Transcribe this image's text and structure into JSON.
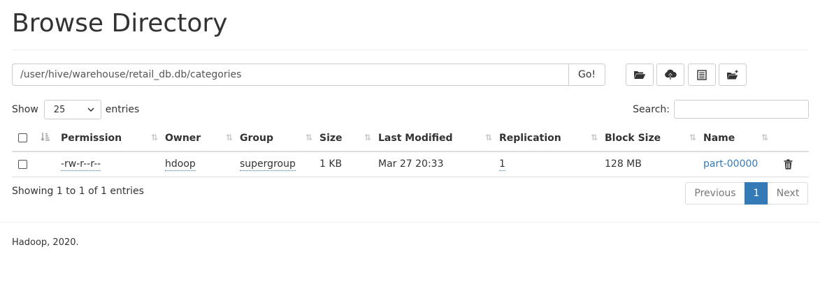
{
  "page": {
    "title": "Browse Directory"
  },
  "path_bar": {
    "value": "/user/hive/warehouse/retail_db.db/categories",
    "go_label": "Go!"
  },
  "toolbar": {
    "icons": [
      "folder-open-icon",
      "upload-icon",
      "list-icon",
      "new-folder-icon"
    ]
  },
  "length": {
    "show_label": "Show",
    "value": "25",
    "entries_label": "entries"
  },
  "search": {
    "label": "Search:",
    "value": ""
  },
  "table": {
    "columns": [
      "Permission",
      "Owner",
      "Group",
      "Size",
      "Last Modified",
      "Replication",
      "Block Size",
      "Name"
    ],
    "rows": [
      {
        "permission": "-rw-r--r--",
        "owner": "hdoop",
        "group": "supergroup",
        "size": "1 KB",
        "last_modified": "Mar 27 20:33",
        "replication": "1",
        "block_size": "128 MB",
        "name": "part-00000"
      }
    ]
  },
  "info": {
    "text": "Showing 1 to 1 of 1 entries"
  },
  "pagination": {
    "previous": "Previous",
    "current": "1",
    "next": "Next"
  },
  "footer": {
    "text": "Hadoop, 2020."
  },
  "colors": {
    "link": "#337ab7",
    "border": "#dddddd",
    "text": "#333333"
  }
}
